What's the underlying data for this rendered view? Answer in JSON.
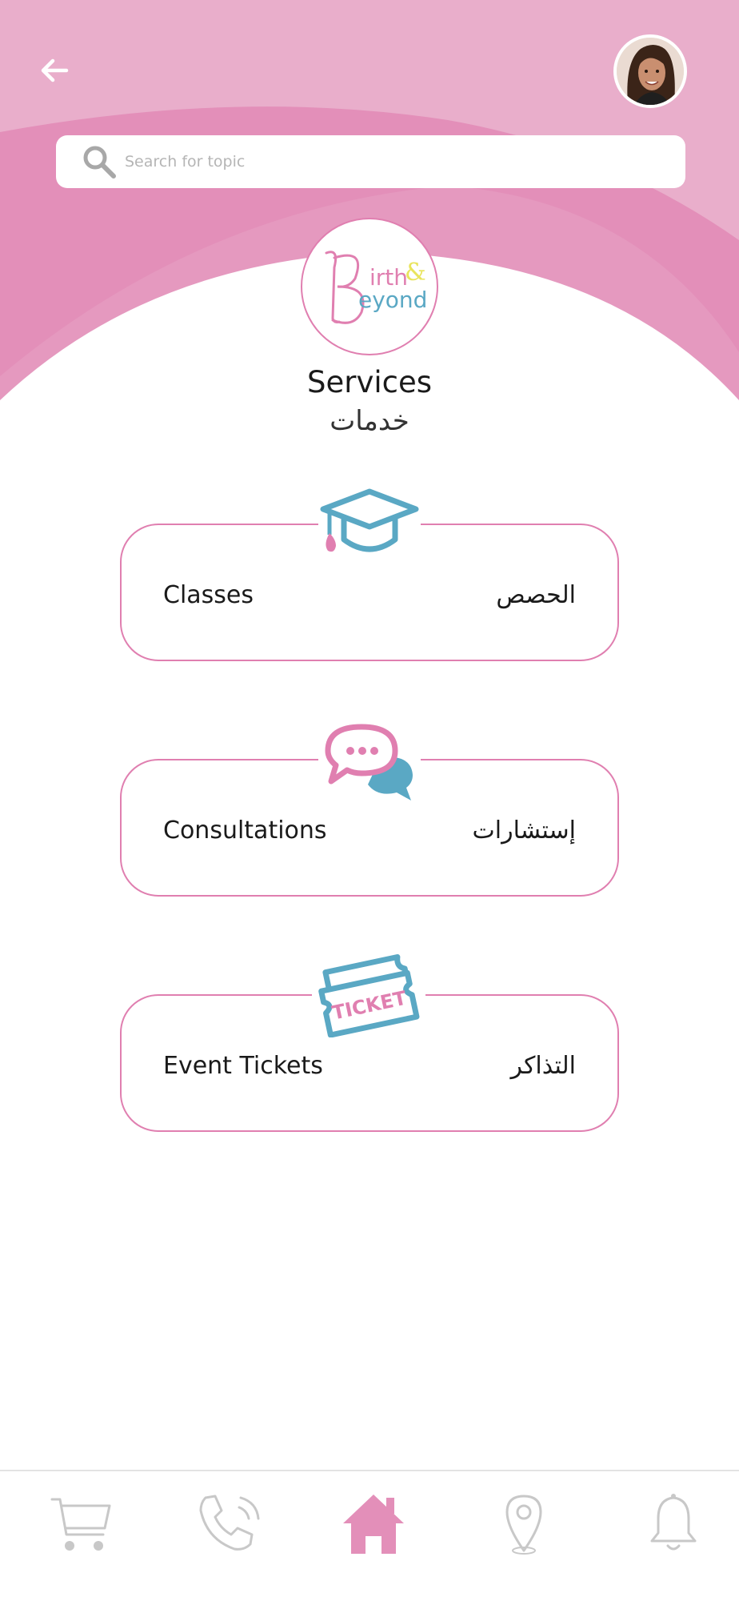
{
  "header": {
    "back_icon": "arrow-left-icon",
    "avatar_icon": "user-avatar"
  },
  "search": {
    "placeholder": "Search for topic",
    "icon": "search-icon"
  },
  "logo": {
    "text_line1": "irth",
    "text_line2": "eyond"
  },
  "page": {
    "title_en": "Services",
    "title_ar": "خدمات"
  },
  "services": [
    {
      "label_en": "Classes",
      "label_ar": "الحصص",
      "icon": "graduation-cap-icon"
    },
    {
      "label_en": "Consultations",
      "label_ar": "إستشارات",
      "icon": "chat-bubbles-icon"
    },
    {
      "label_en": "Event Tickets",
      "label_ar": "التذاكر",
      "icon": "ticket-icon",
      "icon_text": "TICKET"
    }
  ],
  "bottom_nav": [
    {
      "icon": "cart-icon",
      "active": false
    },
    {
      "icon": "phone-icon",
      "active": false
    },
    {
      "icon": "home-icon",
      "active": true
    },
    {
      "icon": "location-pin-icon",
      "active": false
    },
    {
      "icon": "bell-icon",
      "active": false
    }
  ],
  "colors": {
    "pink_light": "#e9aecb",
    "pink_mid": "#e38fb9",
    "pink_accent": "#e07fb0",
    "teal": "#5aa8c4",
    "nav_inactive": "#c8c8c8"
  }
}
